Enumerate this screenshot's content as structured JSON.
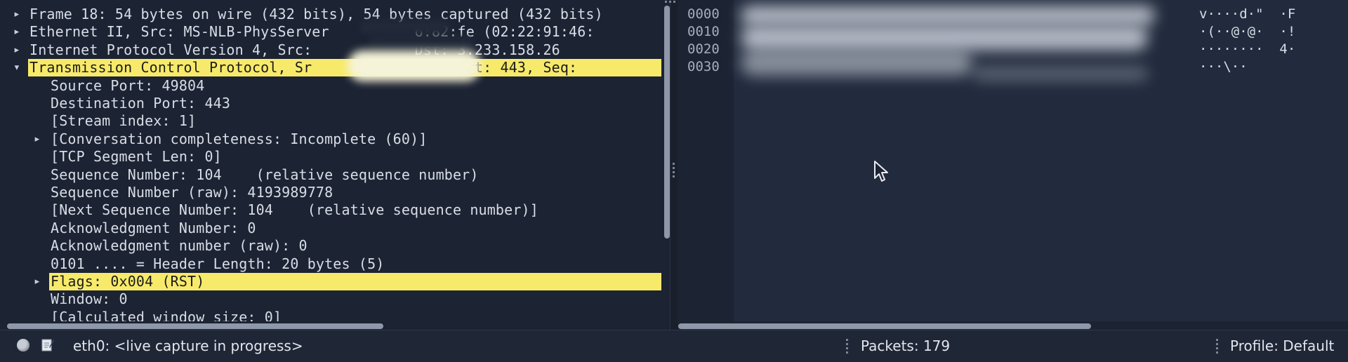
{
  "details": {
    "rows": [
      {
        "text": "Frame 18: 54 bytes on wire (432 bits), 54 bytes captured (432 bits)",
        "expander": "collapsed"
      },
      {
        "text": "Ethernet II, Src: MS-NLB-PhysServer          6:82:fe (02:22:91:46:",
        "expander": "collapsed"
      },
      {
        "text": "Internet Protocol Version 4, Src:            Dst: 3.233.158.26",
        "expander": "collapsed"
      },
      {
        "text": "Transmission Control Protocol, Sr            Dst Port: 443, Seq:",
        "expander": "expanded"
      },
      {
        "text": "Source Port: 49804",
        "expander": "none"
      },
      {
        "text": "Destination Port: 443",
        "expander": "none"
      },
      {
        "text": "[Stream index: 1]",
        "expander": "none"
      },
      {
        "text": "[Conversation completeness: Incomplete (60)]",
        "expander": "collapsed"
      },
      {
        "text": "[TCP Segment Len: 0]",
        "expander": "none"
      },
      {
        "text": "Sequence Number: 104    (relative sequence number)",
        "expander": "none"
      },
      {
        "text": "Sequence Number (raw): 4193989778",
        "expander": "none"
      },
      {
        "text": "[Next Sequence Number: 104    (relative sequence number)]",
        "expander": "none"
      },
      {
        "text": "Acknowledgment Number: 0",
        "expander": "none"
      },
      {
        "text": "Acknowledgment number (raw): 0",
        "expander": "none"
      },
      {
        "text": "0101 .... = Header Length: 20 bytes (5)",
        "expander": "none"
      },
      {
        "text": "Flags: 0x004 (RST)",
        "expander": "collapsed"
      },
      {
        "text": "Window: 0",
        "expander": "none"
      },
      {
        "text": "[Calculated window size: 0]",
        "expander": "none"
      }
    ]
  },
  "bytes": {
    "offsets": [
      "0000",
      "0010",
      "0020",
      "0030"
    ],
    "ascii": [
      "v····d·\"  ·F",
      "·(··@·@·  ·!",
      "········  4·",
      "···\\··"
    ]
  },
  "status": {
    "interface": "eth0: <live capture in progress>",
    "packets": "Packets: 179",
    "profile": "Profile: Default"
  },
  "colors": {
    "background": "#1c2333",
    "highlight": "#f7ea6a",
    "text": "#d8dde6"
  }
}
